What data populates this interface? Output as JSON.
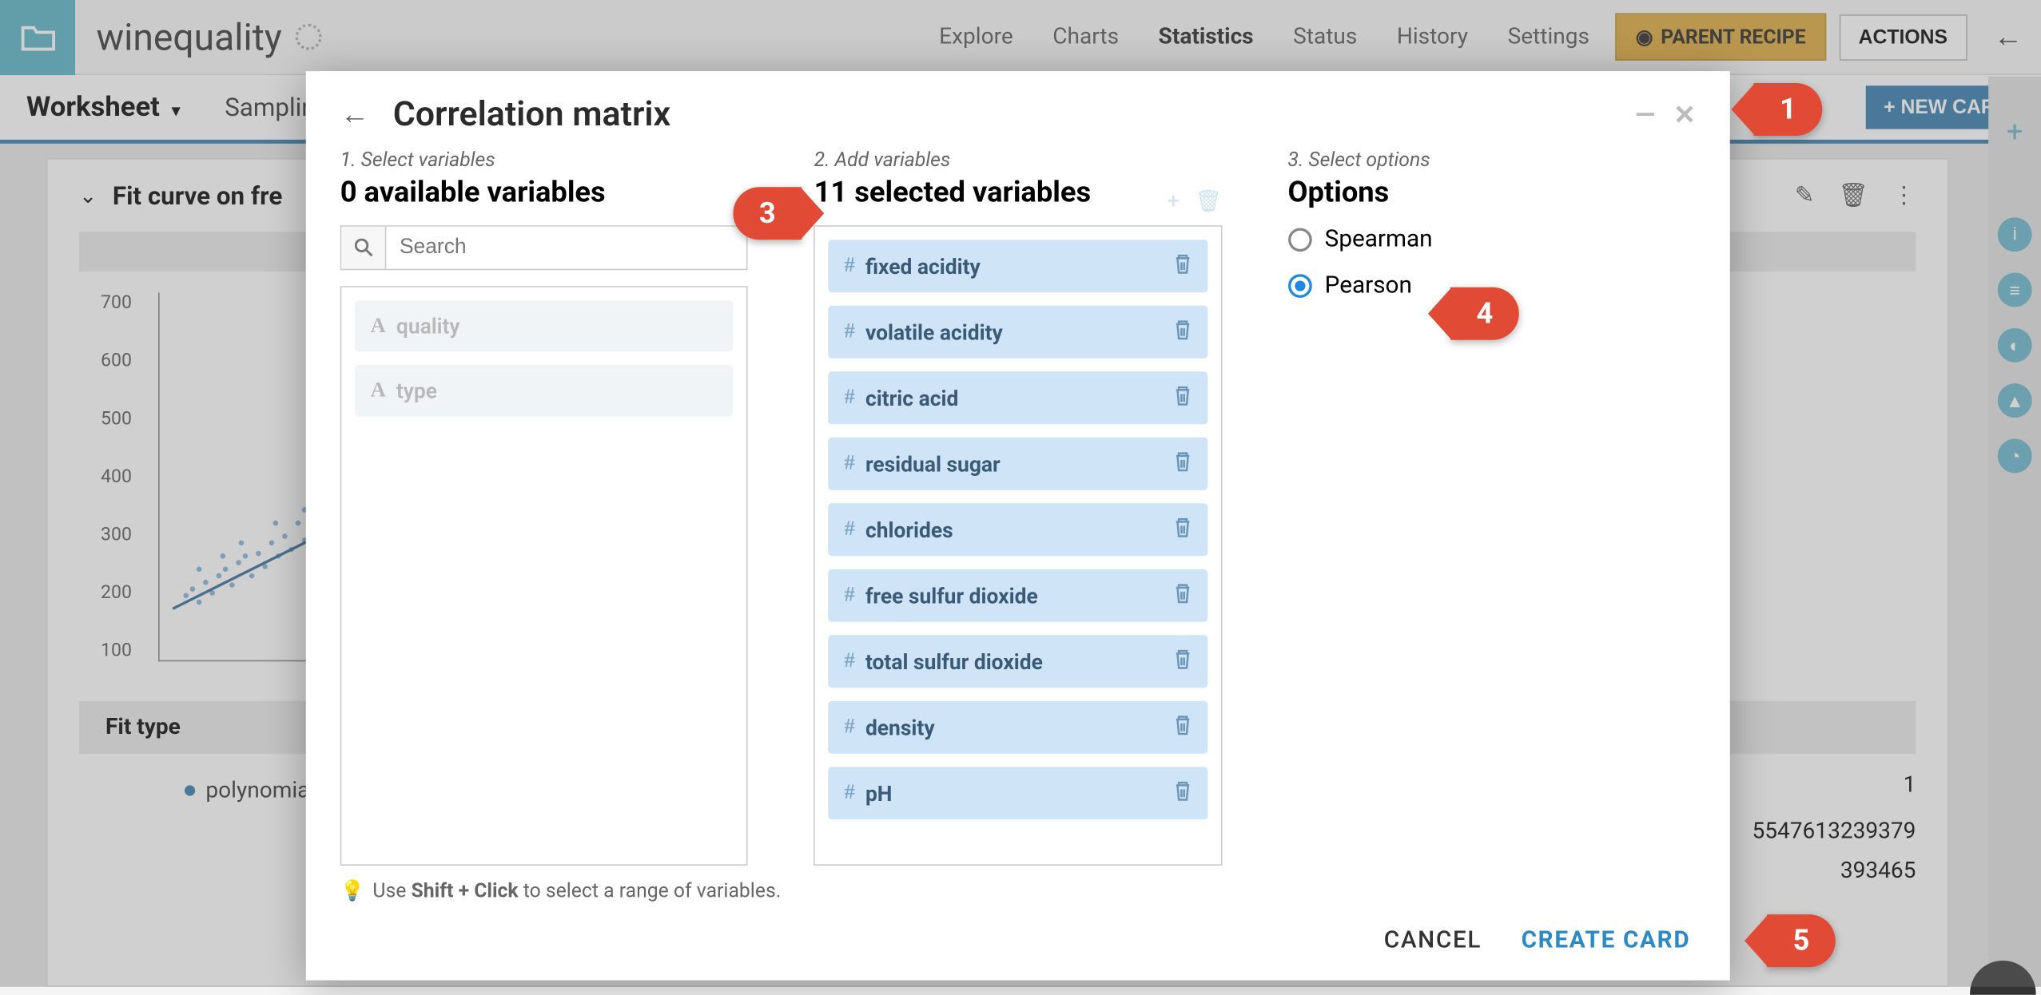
{
  "topbar": {
    "title": "winequality",
    "nav": [
      "Explore",
      "Charts",
      "Statistics",
      "Status",
      "History",
      "Settings"
    ],
    "nav_active_idx": 2,
    "parent_recipe": "PARENT RECIPE",
    "actions": "ACTIONS"
  },
  "secondbar": {
    "worksheet": "Worksheet",
    "sampling": "Samplin",
    "new_card": "+ NEW CARD"
  },
  "bg_card": {
    "title": "Fit curve on fre",
    "fit_type_label": "Fit type",
    "fit_type_value": "polynomial",
    "y_ticks": [
      "700",
      "600",
      "500",
      "400",
      "300",
      "200",
      "100"
    ],
    "right_num_1": "1",
    "right_num_2": "5547613239379",
    "right_num_3": "393465"
  },
  "modal": {
    "title": "Correlation matrix",
    "step1": {
      "label": "1. Select variables",
      "heading": "0 available variables"
    },
    "step2": {
      "label": "2. Add variables",
      "heading": "11 selected variables"
    },
    "step3": {
      "label": "3. Select options",
      "heading": "Options"
    },
    "search_placeholder": "Search",
    "available": [
      "quality",
      "type"
    ],
    "selected": [
      "fixed acidity",
      "volatile acidity",
      "citric acid",
      "residual sugar",
      "chlorides",
      "free sulfur dioxide",
      "total sulfur dioxide",
      "density",
      "pH"
    ],
    "options": [
      {
        "label": "Spearman",
        "selected": false
      },
      {
        "label": "Pearson",
        "selected": true
      }
    ],
    "tip_prefix": "Use ",
    "tip_bold": "Shift + Click",
    "tip_suffix": " to select a range of variables.",
    "cancel": "CANCEL",
    "create": "CREATE CARD"
  },
  "callouts": {
    "c1": "1",
    "c3": "3",
    "c4": "4",
    "c5": "5"
  }
}
